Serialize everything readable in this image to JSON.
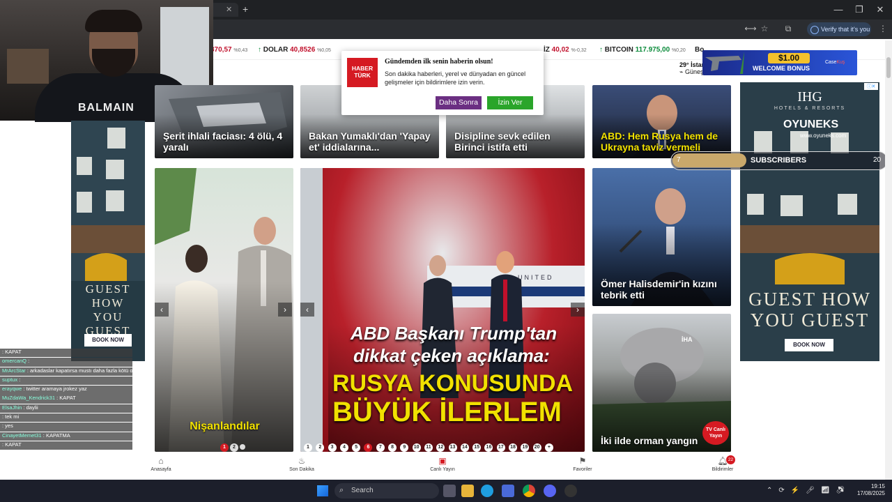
{
  "browser": {
    "tab_close": "✕",
    "new_tab": "+",
    "verify_label": "Verify that it's you",
    "window_min": "—",
    "window_max": "❐",
    "window_close": "✕"
  },
  "ticker": {
    "items": [
      {
        "value": "870,57",
        "pct": "%0,43"
      },
      {
        "name": "DOLAR",
        "value": "40,8526",
        "pct": "%0,05"
      },
      {
        "name": "İZ",
        "value": "40,02",
        "pct": "%-0,32"
      },
      {
        "name": "BITCOIN",
        "value": "117.975,00",
        "pct": "%0,20"
      },
      {
        "name": "Bo"
      }
    ]
  },
  "weather": {
    "temp": "29°",
    "city": "İstanbul",
    "desc": "Güneşli"
  },
  "webcam": {
    "shirt_text": "BALMAIN"
  },
  "left_ad": {
    "headline": "GUEST HOW YOU GUEST",
    "button": "BOOK NOW"
  },
  "right_ad": {
    "brand": "IHG",
    "brand_sub": "HOTELS & RESORTS",
    "overlay_brand": "OYUNEKS",
    "overlay_url": "www.oyuneks.com",
    "headline": "GUEST HOW YOU GUEST",
    "button": "BOOK NOW"
  },
  "casino_banner": {
    "amount": "$1.00",
    "text": "WELCOME BONUS",
    "brand": "Case"
  },
  "subs_bar": {
    "current": "7",
    "label": "SUBSCRIBERS",
    "goal": "20"
  },
  "popup": {
    "logo_line1": "HABER",
    "logo_line2": "TÜRK",
    "title": "Gündemden ilk senin haberin olsun!",
    "text": "Son dakika haberleri, yerel ve dünyadan en güncel gelişmeler için bildirimlere izin verin.",
    "later": "Daha Sonra",
    "allow": "İzin Ver"
  },
  "news": {
    "top": [
      {
        "title": "Şerit ihlali faciası: 4 ölü, 4 yaralı"
      },
      {
        "title": "Bakan Yumaklı'dan 'Yapay et' iddialarına..."
      },
      {
        "title": "Disipline sevk edilen Birinci istifa etti"
      },
      {
        "title": "ABD: Hem Rusya hem de Ukrayna taviz vermeli"
      }
    ],
    "left_slider": {
      "title": "Nişanlandılar",
      "pages": [
        "1",
        "2",
        "3"
      ]
    },
    "main_slider": {
      "line1": "ABD Başkanı Trump'tan",
      "line2": "dikkat çeken açıklama:",
      "line3": "RUSYA KONUSUNDA",
      "line4": "BÜYÜK İLERLEM",
      "plane_text": "UNITED",
      "pages": [
        "1",
        "2",
        "3",
        "4",
        "5",
        "6",
        "7",
        "8",
        "9",
        "10",
        "11",
        "12",
        "13",
        "14",
        "15",
        "16",
        "17",
        "18",
        "19",
        "20",
        "+"
      ]
    },
    "right1": {
      "title": "Ömer Halisdemir'in kızını tebrik etti"
    },
    "right2": {
      "title": "İki ilde orman yangın",
      "badge": "TV Canlı Yayın",
      "agency": "İHA"
    }
  },
  "chat": [
    {
      "user": "",
      "msg": "KAPAT"
    },
    {
      "user": "omercanQ",
      "msg": ""
    },
    {
      "user": "MrArcStar",
      "msg": "arkadaslar kapatırsa mustı daha fazla kötü olacak"
    },
    {
      "user": "suptux",
      "msg": ""
    },
    {
      "user": "erayqwe",
      "msg": "twitter aramaya jrokez yaz"
    },
    {
      "user": "MuZdaWa_Kendrick31",
      "msg": "KAPAT"
    },
    {
      "user": "ElsaJhin",
      "msg": "daylii"
    },
    {
      "user": "",
      "msg": "tek mi"
    },
    {
      "user": "",
      "msg": "yes"
    },
    {
      "user": "CinayetMemet31",
      "msg": "KAPATMA"
    },
    {
      "user": "",
      "msg": "KAPAT"
    }
  ],
  "bottom_nav": [
    {
      "label": "Anasayfa",
      "icon": "home-icon"
    },
    {
      "label": "Son Dakika",
      "icon": "flame-icon"
    },
    {
      "label": "Canlı Yayın",
      "icon": "tv-icon"
    },
    {
      "label": "Favoriler",
      "icon": "bookmark-icon"
    },
    {
      "label": "Bildirimler",
      "icon": "bell-icon",
      "badge": "22"
    }
  ],
  "taskbar": {
    "search": "Search",
    "time": "19:15",
    "date": "17/08/2025"
  },
  "colors": {
    "brand_red": "#d51a22",
    "later_btn": "#6b2f82",
    "allow_btn": "#2aa52a",
    "news_yellow": "#f1e100"
  }
}
